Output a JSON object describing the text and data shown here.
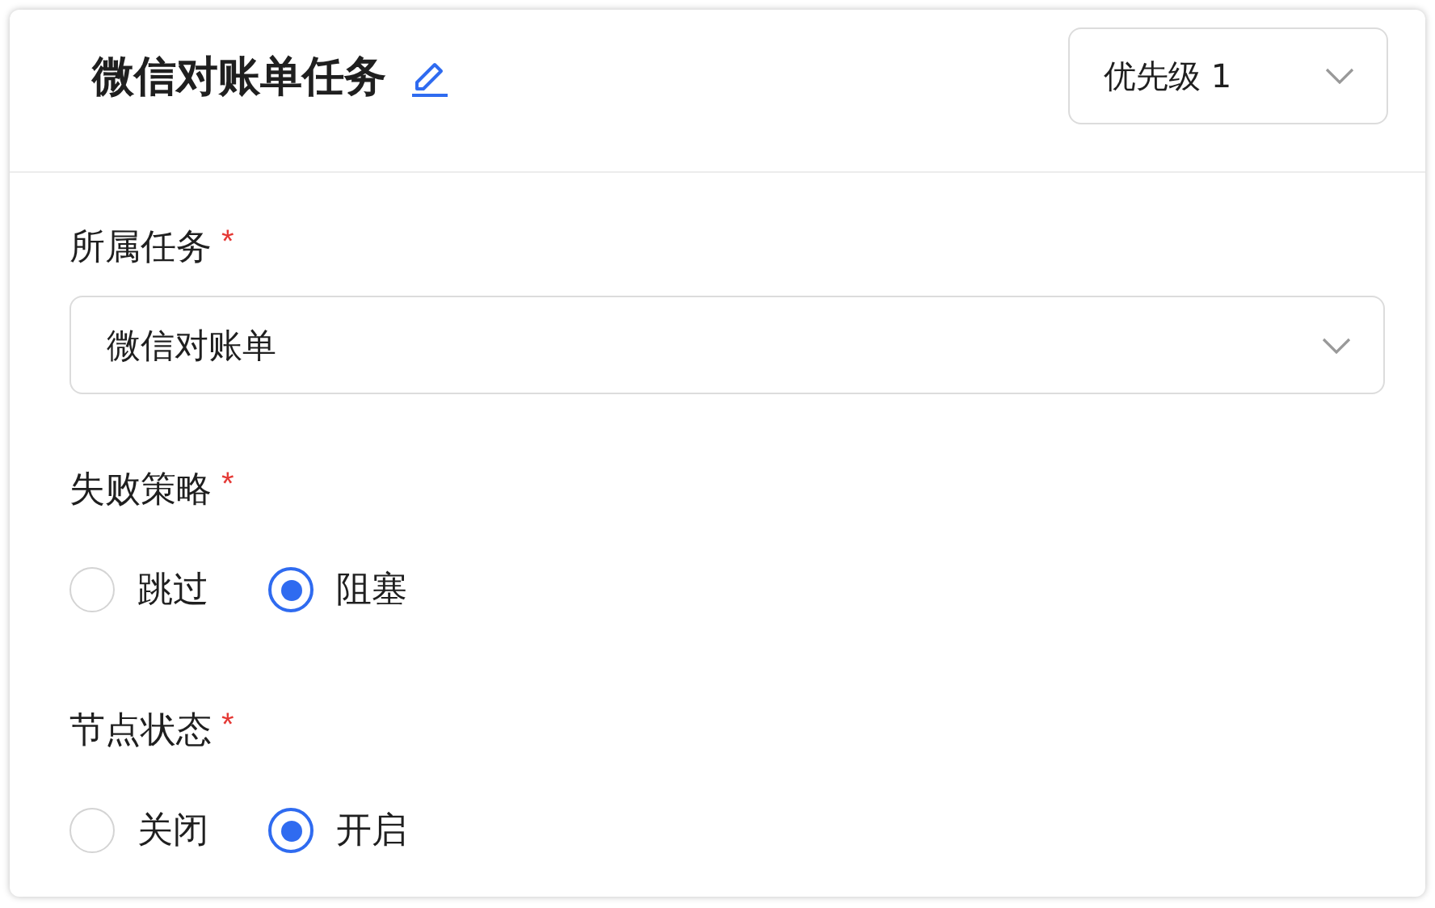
{
  "header": {
    "title": "微信对账单任务",
    "priority": {
      "value": "优先级 1"
    }
  },
  "fields": [
    {
      "kind": "select",
      "label": "所属任务",
      "required_mark": "*",
      "value": "微信对账单"
    },
    {
      "kind": "radio",
      "label": "失败策略",
      "required_mark": "*",
      "options": [
        {
          "label": "跳过",
          "selected": false
        },
        {
          "label": "阻塞",
          "selected": true
        }
      ]
    },
    {
      "kind": "radio",
      "label": "节点状态",
      "required_mark": "*",
      "options": [
        {
          "label": "关闭",
          "selected": false
        },
        {
          "label": "开启",
          "selected": true
        }
      ]
    }
  ]
}
